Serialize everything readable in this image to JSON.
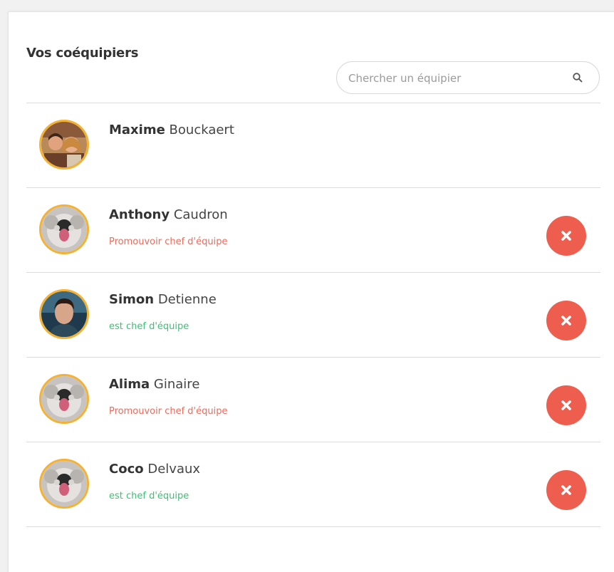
{
  "panel": {
    "title": "Vos coéquipiers"
  },
  "search": {
    "placeholder": "Chercher un équipier",
    "icon": "search-icon"
  },
  "colors": {
    "avatar_ring": "#f5b132",
    "promote_link": "#ee6a5a",
    "chef_status": "#3fbf74",
    "remove_button": "#ee5e4e"
  },
  "members": [
    {
      "first_name": "Maxime",
      "last_name": "Bouckaert",
      "status": "",
      "status_type": "none",
      "removable": false,
      "avatar": "group-photo"
    },
    {
      "first_name": "Anthony",
      "last_name": "Caudron",
      "status": "Promouvoir chef d'équipe",
      "status_type": "promote",
      "removable": true,
      "avatar": "dog-photo"
    },
    {
      "first_name": "Simon",
      "last_name": "Detienne",
      "status": "est chef d'équipe",
      "status_type": "chef",
      "removable": true,
      "avatar": "man-photo"
    },
    {
      "first_name": "Alima",
      "last_name": "Ginaire",
      "status": "Promouvoir chef d'équipe",
      "status_type": "promote",
      "removable": true,
      "avatar": "dog-photo"
    },
    {
      "first_name": "Coco",
      "last_name": "Delvaux",
      "status": "est chef d'équipe",
      "status_type": "chef",
      "removable": true,
      "avatar": "dog-photo"
    }
  ]
}
